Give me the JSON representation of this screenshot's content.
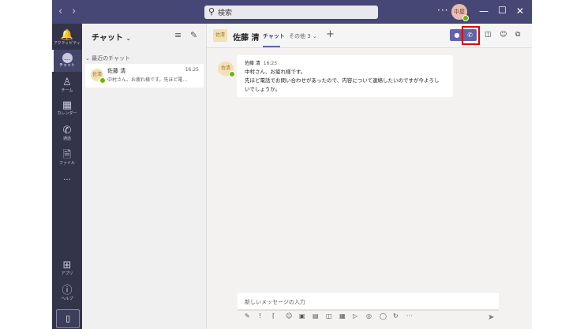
{
  "titlebar": {
    "search_placeholder": "検索",
    "user_initials": "中屋"
  },
  "rail": {
    "items": [
      {
        "label": "アクティビティ"
      },
      {
        "label": "チャット"
      },
      {
        "label": "チーム"
      },
      {
        "label": "カレンダー"
      },
      {
        "label": "通話"
      },
      {
        "label": "ファイル"
      }
    ],
    "more": "···",
    "apps_label": "アプリ",
    "help_label": "ヘルプ"
  },
  "chatlist": {
    "title": "チャット",
    "section": "最近のチャット",
    "items": [
      {
        "avatar": "佐清",
        "name": "佐藤 清",
        "time": "16:25",
        "preview": "中村さん、お疲れ様です。先ほど電..."
      }
    ]
  },
  "conversation": {
    "avatar": "佐清",
    "name": "佐藤 清",
    "tabs": {
      "chat": "チャット",
      "more": "その他 3"
    }
  },
  "message": {
    "avatar": "佐清",
    "sender": "佐藤 清",
    "time": "16:25",
    "lines": [
      "中村さん、お疲れ様です。",
      "先ほど電話でお問い合わせがあったので、内容について連絡したいのですが今よろし",
      "いでしょうか。"
    ]
  },
  "compose": {
    "placeholder": "新しいメッセージの入力"
  },
  "colors": {
    "titlebar": "#464775",
    "rail": "#33344a",
    "accent": "#6264a7",
    "highlight": "#e00000",
    "presence": "#6bb700"
  }
}
